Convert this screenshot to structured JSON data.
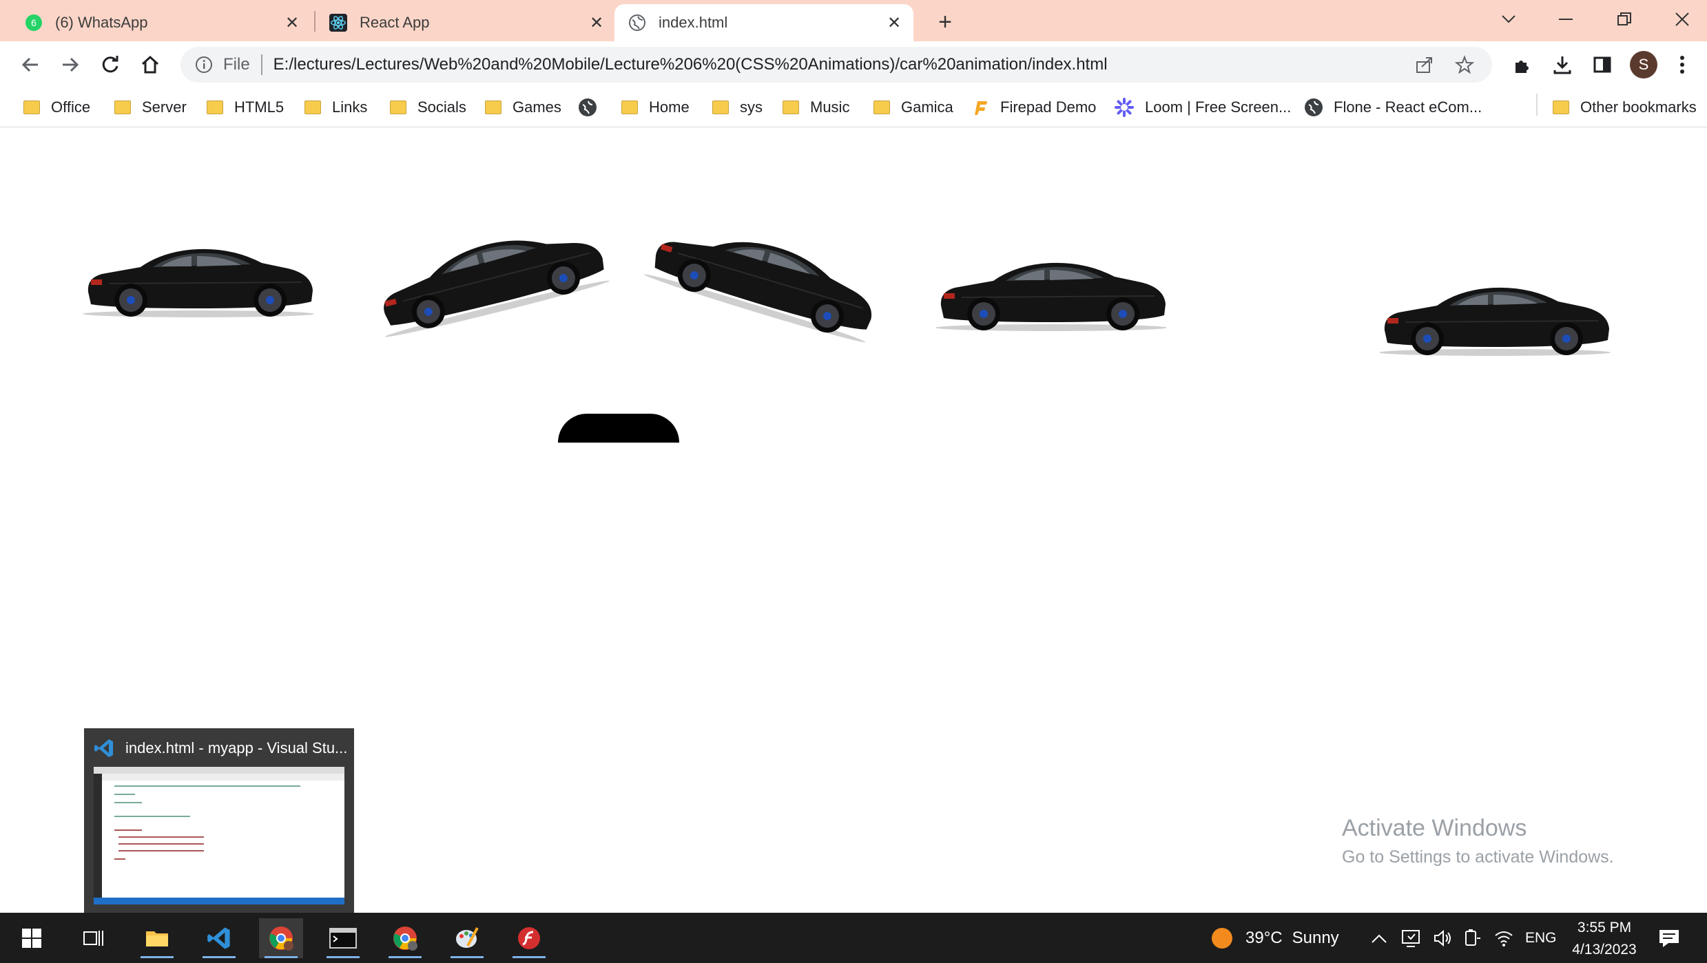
{
  "browser": {
    "tabs": [
      {
        "title": "(6) WhatsApp",
        "badge": "6",
        "icon": "whatsapp-icon"
      },
      {
        "title": "React App",
        "icon": "react-icon"
      },
      {
        "title": "index.html",
        "icon": "globe-icon",
        "active": true
      }
    ],
    "address": {
      "scheme": "File",
      "url": "E:/lectures/Lectures/Web%20and%20Mobile/Lecture%206%20(CSS%20Animations)/car%20animation/index.html"
    },
    "profile_initial": "S"
  },
  "bookmarks": [
    {
      "label": "Office",
      "icon": "folder-icon"
    },
    {
      "label": "Server",
      "icon": "folder-icon"
    },
    {
      "label": "HTML5",
      "icon": "folder-icon"
    },
    {
      "label": "Links",
      "icon": "folder-icon"
    },
    {
      "label": "Socials",
      "icon": "folder-icon"
    },
    {
      "label": "Games",
      "icon": "folder-icon"
    },
    {
      "label": "",
      "icon": "globe-icon"
    },
    {
      "label": "Home",
      "icon": "folder-icon"
    },
    {
      "label": "sys",
      "icon": "folder-icon"
    },
    {
      "label": "Music",
      "icon": "folder-icon"
    },
    {
      "label": "Gamica",
      "icon": "folder-icon"
    },
    {
      "label": "Firepad Demo",
      "icon": "firepad-icon"
    },
    {
      "label": "Loom | Free Screen...",
      "icon": "loom-icon"
    },
    {
      "label": "Flone - React eCom...",
      "icon": "globe-icon"
    }
  ],
  "other_bookmarks": "Other bookmarks",
  "watermark": {
    "line1": "Activate Windows",
    "line2": "Go to Settings to activate Windows."
  },
  "preview": {
    "title": "index.html - myapp - Visual Stu..."
  },
  "taskbar": {
    "weather_temp": "39°C",
    "weather_desc": "Sunny",
    "language": "ENG",
    "time": "3:55 PM",
    "date": "4/13/2023"
  },
  "colors": {
    "tabstrip": "#fbd6c8",
    "taskbar": "#1c1c1c",
    "car_body": "#111111",
    "semicircle": "#000000"
  }
}
